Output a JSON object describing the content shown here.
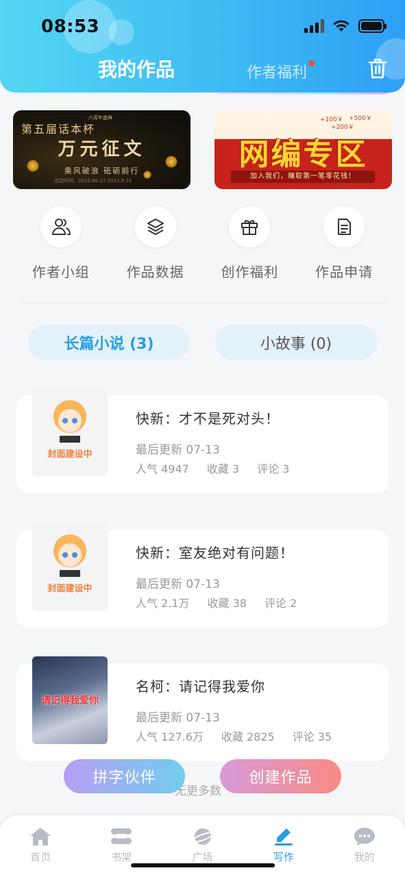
{
  "status_bar": {
    "time": "08:53"
  },
  "header": {
    "tab_active": "我的作品",
    "tab_inactive": "作者福利",
    "trash_icon": "trash-icon"
  },
  "banners": {
    "left": {
      "top_text": "第五届话本杯",
      "tiny_text": "六周年盛典",
      "title": "万元征文",
      "subtitle": "乘风破浪 砥砺前行",
      "date_text": "活动时间：2022.06.27-2022.8.15"
    },
    "right": {
      "amounts": [
        "+100￥",
        "+500￥",
        "+200￥"
      ],
      "title": "网编专区",
      "strip": "加入我们，赚取第一笔零花钱！"
    }
  },
  "quick_entries": [
    {
      "label": "作者小组",
      "icon": "users-icon"
    },
    {
      "label": "作品数据",
      "icon": "layers-icon"
    },
    {
      "label": "创作福利",
      "icon": "gift-icon"
    },
    {
      "label": "作品申请",
      "icon": "document-icon"
    }
  ],
  "segments": {
    "left": "长篇小说 (3)",
    "right": "小故事 (0)"
  },
  "works": [
    {
      "cover_label": "封面建设中",
      "title": "快新：才不是死对头！",
      "updated": "最后更新 07-13",
      "popularity": "人气 4947",
      "favorites": "收藏 3",
      "comments": "评论 3"
    },
    {
      "cover_label": "封面建设中",
      "title": "快新：室友绝对有问题！",
      "updated": "最后更新 07-13",
      "popularity": "人气 2.1万",
      "favorites": "收藏 38",
      "comments": "评论 2"
    },
    {
      "cover_label": "",
      "cover_text": "请记得我爱你",
      "title": "名柯：请记得我爱你",
      "updated": "最后更新 07-13",
      "popularity": "人气 127.6万",
      "favorites": "收藏 2825",
      "comments": "评论 35"
    }
  ],
  "footer_text": "无更多数",
  "float_buttons": {
    "left": "拼字伙伴",
    "right": "创建作品"
  },
  "bottom_nav": [
    {
      "label": "首页",
      "icon": "home-icon"
    },
    {
      "label": "书架",
      "icon": "bookshelf-icon"
    },
    {
      "label": "广场",
      "icon": "planet-icon"
    },
    {
      "label": "写作",
      "icon": "pen-icon",
      "active": true
    },
    {
      "label": "我的",
      "icon": "chat-icon"
    }
  ],
  "colors": {
    "accent": "#2a9de0",
    "header_start": "#53d6f3",
    "header_end": "#2d9ff5",
    "inactive_nav": "#b8bcc4"
  }
}
